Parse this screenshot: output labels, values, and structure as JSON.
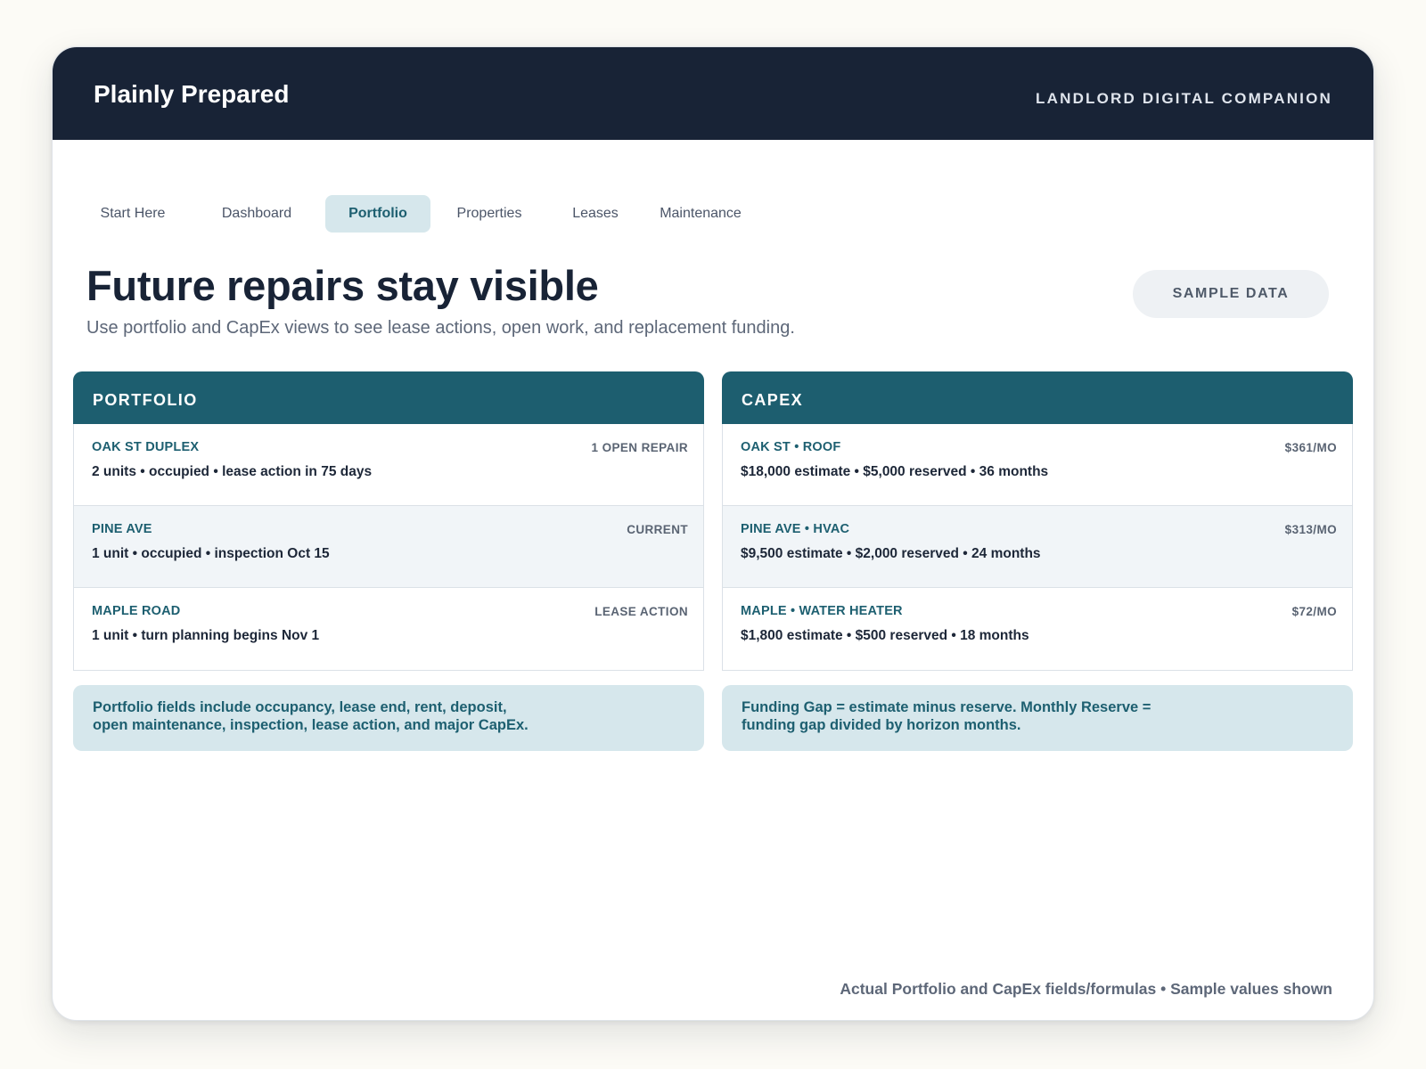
{
  "app": {
    "brand": "Plainly Prepared",
    "tagline": "LANDLORD DIGITAL COMPANION"
  },
  "tabs": [
    {
      "label": "Start Here",
      "active": false
    },
    {
      "label": "Dashboard",
      "active": false
    },
    {
      "label": "Portfolio",
      "active": true
    },
    {
      "label": "Properties",
      "active": false
    },
    {
      "label": "Leases",
      "active": false
    },
    {
      "label": "Maintenance",
      "active": false
    }
  ],
  "page": {
    "title": "Future repairs stay visible",
    "subtitle": "Use portfolio and CapEx views to see lease actions, open work, and replacement funding.",
    "badge": "SAMPLE DATA"
  },
  "portfolio": {
    "heading": "PORTFOLIO",
    "rows": [
      {
        "name": "OAK ST DUPLEX",
        "status": "1 OPEN REPAIR",
        "detail": "2 units • occupied • lease action in 75 days"
      },
      {
        "name": "PINE AVE",
        "status": "CURRENT",
        "detail": "1 unit • occupied • inspection Oct 15"
      },
      {
        "name": "MAPLE ROAD",
        "status": "LEASE ACTION",
        "detail": "1 unit • turn planning begins Nov 1"
      }
    ],
    "note_line1": "Portfolio fields include occupancy, lease end, rent, deposit,",
    "note_line2": "open maintenance, inspection, lease action, and major CapEx."
  },
  "capex": {
    "heading": "CAPEX",
    "rows": [
      {
        "name": "OAK ST • ROOF",
        "status": "$361/MO",
        "detail": "$18,000 estimate • $5,000 reserved • 36 months"
      },
      {
        "name": "PINE AVE • HVAC",
        "status": "$313/MO",
        "detail": "$9,500 estimate • $2,000 reserved • 24 months"
      },
      {
        "name": "MAPLE • WATER HEATER",
        "status": "$72/MO",
        "detail": "$1,800 estimate • $500 reserved • 18 months"
      }
    ],
    "note_line1": "Funding Gap = estimate minus reserve. Monthly Reserve =",
    "note_line2": "funding gap divided by horizon months."
  },
  "footer": "Actual Portfolio and CapEx fields/formulas • Sample values shown",
  "colors": {
    "header_bg": "#182336",
    "accent": "#1d5e6f",
    "accent_light": "#d6e7ec",
    "page_bg": "#fcfbf6"
  }
}
